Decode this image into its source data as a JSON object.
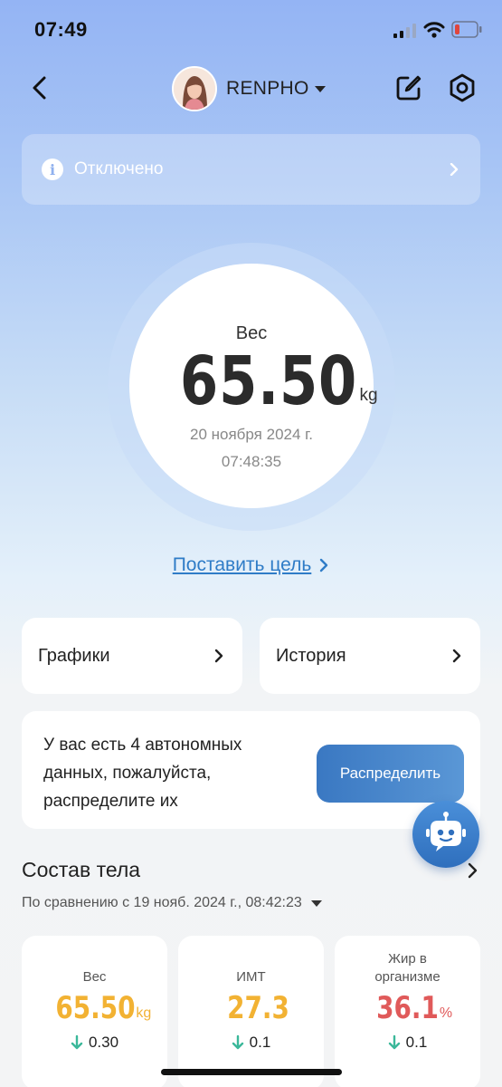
{
  "status_bar": {
    "time": "07:49"
  },
  "header": {
    "user_name": "RENPHO"
  },
  "banner": {
    "text": "Отключено"
  },
  "weight": {
    "label": "Вес",
    "value": "65.50",
    "unit": "kg",
    "date": "20 ноября 2024 г.",
    "time": "07:48:35"
  },
  "goal_link": "Поставить цель",
  "nav_cards": {
    "charts": "Графики",
    "history": "История"
  },
  "offline": {
    "text": "У вас есть 4 автономных данных, пожалуйста, распределите их",
    "button": "Распределить"
  },
  "body_composition": {
    "title": "Состав тела",
    "compare": "По сравнению с 19 нояб. 2024 г., 08:42:23",
    "metrics": [
      {
        "label": "Вес",
        "value": "65.50",
        "unit": "kg",
        "delta": "0.30",
        "color": "#f2b233"
      },
      {
        "label": "ИМТ",
        "value": "27.3",
        "unit": "",
        "delta": "0.1",
        "color": "#f2b233"
      },
      {
        "label": "Жир в организме",
        "value": "36.1",
        "unit": "%",
        "delta": "0.1",
        "color": "#e05a5a"
      }
    ]
  },
  "colors": {
    "accent": "#3a78c2",
    "link": "#2f7cc7",
    "delta_arrow": "#3bb89a"
  }
}
